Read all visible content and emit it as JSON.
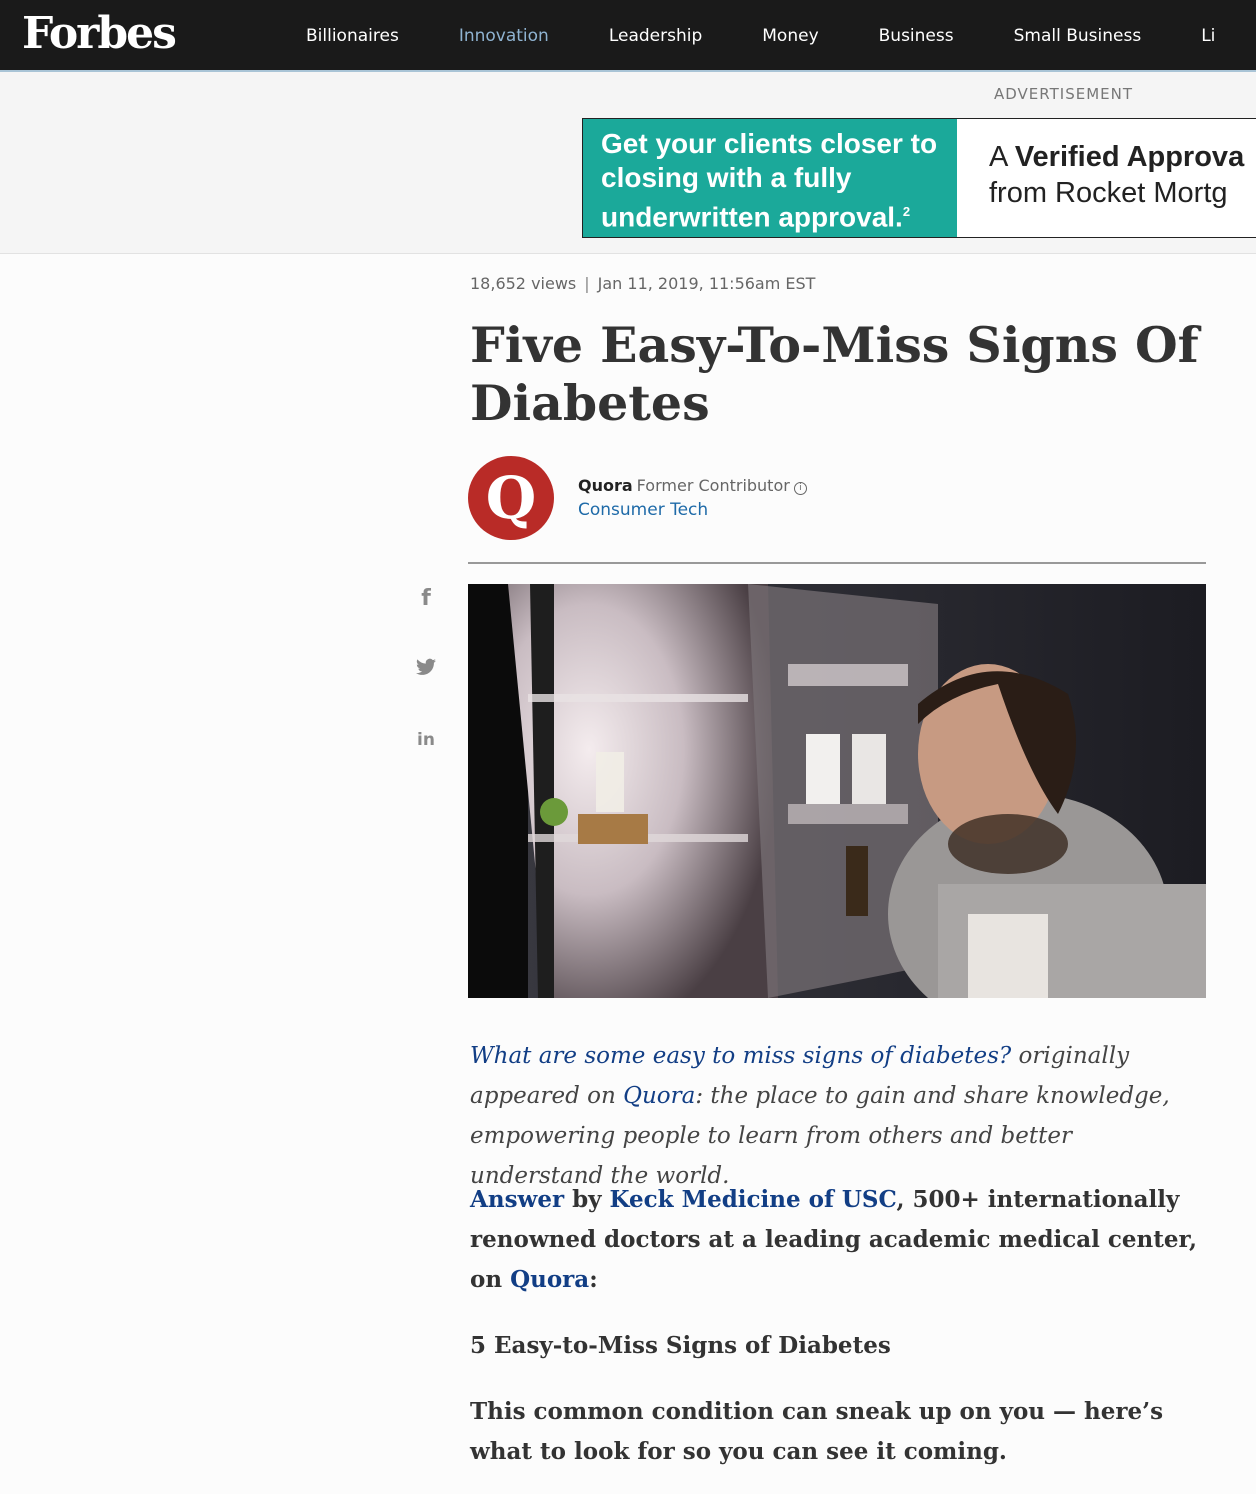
{
  "header": {
    "logo": "Forbes",
    "nav": [
      "Billionaires",
      "Innovation",
      "Leadership",
      "Money",
      "Business",
      "Small Business",
      "Li"
    ]
  },
  "ad": {
    "label": "ADVERTISEMENT",
    "left_text": "Get your clients closer to closing with a fully underwritten approval.",
    "left_sup": "2",
    "right_line1_prefix": "A ",
    "right_line1_bold": "Verified Approva",
    "right_line2": "from Rocket Mortg"
  },
  "article": {
    "views": "18,652 views",
    "date": "Jan 11, 2019, 11:56am EST",
    "title": "Five Easy-To-Miss Signs Of Diabetes",
    "author_initial": "Q",
    "author_name": "Quora",
    "author_role": "Former Contributor",
    "author_info_icon": "i",
    "channel": "Consumer Tech",
    "hero_alt": "Man looking into an open refrigerator at night"
  },
  "social": {
    "facebook": "f",
    "twitter": "🐦",
    "linkedin": "in"
  },
  "body": {
    "p1_link": "What are some easy to miss signs of diabetes?",
    "p1_a": " originally appeared on ",
    "p1_link2": "Quora",
    "p1_b": ": the place to gain and share knowledge, empowering people to learn from others and better understand the world.",
    "p2_link": "Answer",
    "p2_a": " by ",
    "p2_link2": "Keck Medicine of USC",
    "p2_b": ", 500+ internationally renowned doctors at a leading academic medical center, on ",
    "p2_link3": "Quora",
    "p2_c": ":",
    "p3": "5 Easy-to-Miss Signs of Diabetes",
    "p4": "This common condition can sneak up on you — here’s what to look for so you can see it coming."
  }
}
